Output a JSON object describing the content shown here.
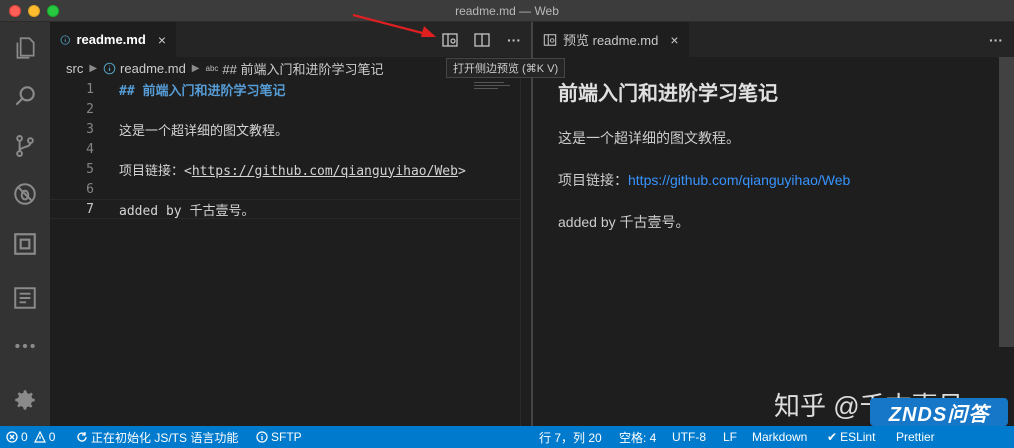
{
  "window": {
    "title": "readme.md — Web"
  },
  "editor_left": {
    "tab": {
      "label": "readme.md",
      "close": "×"
    },
    "tooltip": "打开侧边预览 (⌘K V)",
    "more": "···",
    "breadcrumb": {
      "folder": "src",
      "file": "readme.md",
      "symbol_tag": "abc",
      "symbol": "## 前端入门和进阶学习笔记"
    },
    "lines": [
      {
        "num": "1",
        "text": "## 前端入门和进阶学习笔记"
      },
      {
        "num": "2",
        "text": ""
      },
      {
        "num": "3",
        "text": "这是一个超详细的图文教程。"
      },
      {
        "num": "4",
        "text": ""
      },
      {
        "num": "5",
        "text_prefix": "项目链接：<",
        "text_link": "https://github.com/qianguyihao/Web",
        "text_suffix": ">"
      },
      {
        "num": "6",
        "text": ""
      },
      {
        "num": "7",
        "text": "added by 千古壹号。"
      }
    ]
  },
  "editor_right": {
    "tab": {
      "label": "预览 readme.md",
      "close": "×"
    },
    "more": "···",
    "preview": {
      "heading": "前端入门和进阶学习笔记",
      "p1": "这是一个超详细的图文教程。",
      "p2_prefix": "项目链接：",
      "p2_link": "https://github.com/qianguyihao/Web",
      "p3": "added by 千古壹号。"
    }
  },
  "statusbar": {
    "errors": "0",
    "warnings": "0",
    "ts_status": "正在初始化 JS/TS 语言功能",
    "sftp": "SFTP",
    "position": "行 7，列 20",
    "indent": "空格: 4",
    "encoding": "UTF-8",
    "eol": "LF",
    "language": "Markdown",
    "eslint": "ESLint",
    "prettier": "Prettier"
  },
  "watermark": {
    "zhihu": "知乎 @千古壹号",
    "znds": "ZNDS问答"
  },
  "colors": {
    "accent": "#007acc",
    "link": "#3794ff",
    "heading": "#569cd6",
    "annotation": "#e02020"
  }
}
